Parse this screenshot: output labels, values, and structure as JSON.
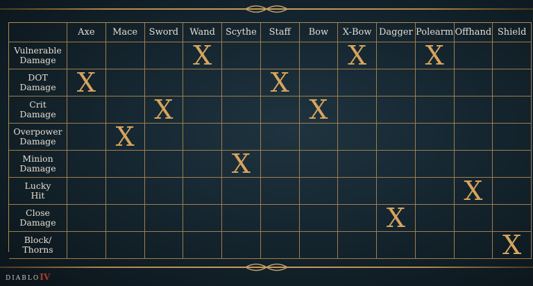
{
  "table": {
    "columns": [
      "Axe",
      "Mace",
      "Sword",
      "Wand",
      "Scythe",
      "Staff",
      "Bow",
      "X-Bow",
      "Dagger",
      "Polearm",
      "Offhand",
      "Shield"
    ],
    "rows": [
      {
        "label": "Vulnerable\nDamage",
        "marks": [
          3,
          7,
          9
        ]
      },
      {
        "label": "DOT\nDamage",
        "marks": [
          0,
          5
        ]
      },
      {
        "label": "Crit\nDamage",
        "marks": [
          2,
          6
        ]
      },
      {
        "label": "Overpower\nDamage",
        "marks": [
          1
        ]
      },
      {
        "label": "Minion\nDamage",
        "marks": [
          4
        ]
      },
      {
        "label": "Lucky\nHit",
        "marks": [
          10
        ]
      },
      {
        "label": "Close\nDamage",
        "marks": [
          8
        ]
      },
      {
        "label": "Block/\nThorns",
        "marks": [
          11
        ]
      }
    ],
    "mark_symbol": "X",
    "mark_color": "#d7a45d",
    "line_color": "#a27e4e"
  },
  "logo": {
    "text": "DIABLO",
    "numeral": "IV"
  }
}
